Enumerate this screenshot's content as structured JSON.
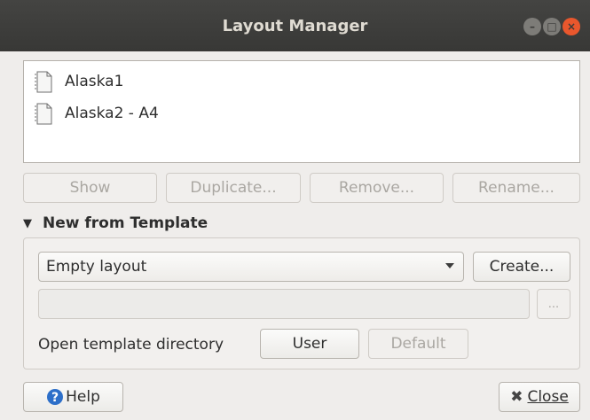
{
  "window": {
    "title": "Layout Manager"
  },
  "layouts": [
    {
      "name": "Alaska1"
    },
    {
      "name": "Alaska2 - A4"
    }
  ],
  "actions": {
    "show": "Show",
    "duplicate": "Duplicate...",
    "remove": "Remove...",
    "rename": "Rename..."
  },
  "template_section": {
    "header": "New from Template",
    "selected_template": "Empty layout",
    "create_label": "Create...",
    "path_value": "",
    "browse_label": "...",
    "directory_label": "Open template directory",
    "user_label": "User",
    "default_label": "Default"
  },
  "footer": {
    "help_label": "Help",
    "close_label": "Close"
  },
  "colors": {
    "titlebar": "#3c3b37",
    "close_button": "#e9572d",
    "help_icon": "#2d6fc9"
  }
}
